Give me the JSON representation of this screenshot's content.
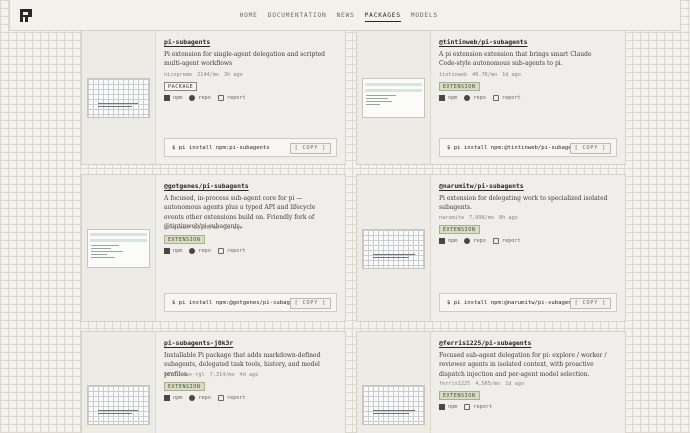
{
  "nav": [
    "HOME",
    "DOCUMENTATION",
    "NEWS",
    "PACKAGES",
    "MODELS"
  ],
  "labels": {
    "copy": "[ COPY ]",
    "npm": "npm",
    "repo": "repo",
    "report": "report"
  },
  "cards": [
    {
      "title": "pi-subagents",
      "desc": "Pi extension for single-agent delegation and scripted multi-agent workflows",
      "author": "nicopreme",
      "downloads": "2144/mo",
      "age": "3h ago",
      "badge": "PACKAGE",
      "install": "$ pi install npm:pi-subagents"
    },
    {
      "title": "@tintinweb/pi-subagents",
      "desc": "A pi extension extension that brings smart Claude Code-style autonomous sub-agents to pi.",
      "author": "tintinweb",
      "downloads": "40.7K/mo",
      "age": "1d ago",
      "badge": "EXTENSION",
      "install": "$ pi install npm:@tintinweb/pi-subagents"
    },
    {
      "title": "@gotgenes/pi-subagents",
      "desc": "A focused, in-process sub-agent core for pi — autonomous agents plus a typed API and lifecycle events other extensions build on. Friendly fork of @tintinweb/pi-subagents.",
      "author": "gotgenes",
      "downloads": "8,460/mo",
      "age": "1d ago",
      "badge": "EXTENSION",
      "install": "$ pi install npm:@gotgenes/pi-subagents"
    },
    {
      "title": "@narumitw/pi-subagents",
      "desc": "Pi extension for delegating work to specialized isolated subagents.",
      "author": "narumitw",
      "downloads": "7,098/mo",
      "age": "8h ago",
      "badge": "EXTENSION",
      "install": "$ pi install npm:@narumitw/pi-subagents"
    },
    {
      "title": "pi-subagents-j0k3r",
      "desc": "Installable Pi package that adds markdown-defined subagents, delegated task tools, history, and model profiles.",
      "author": "j0k3r-dev-rgl",
      "downloads": "7,314/mo",
      "age": "4d ago",
      "badge": "EXTENSION"
    },
    {
      "title": "@ferris1225/pi-subagents",
      "desc": "Focused sub-agent delegation for pi: explore / worker / reviewer agents in isolated context, with proactive dispatch injection and per-agent model selection.",
      "author": "ferris1225",
      "downloads": "4,565/mo",
      "age": "1d ago",
      "badge": "EXTENSION"
    }
  ]
}
